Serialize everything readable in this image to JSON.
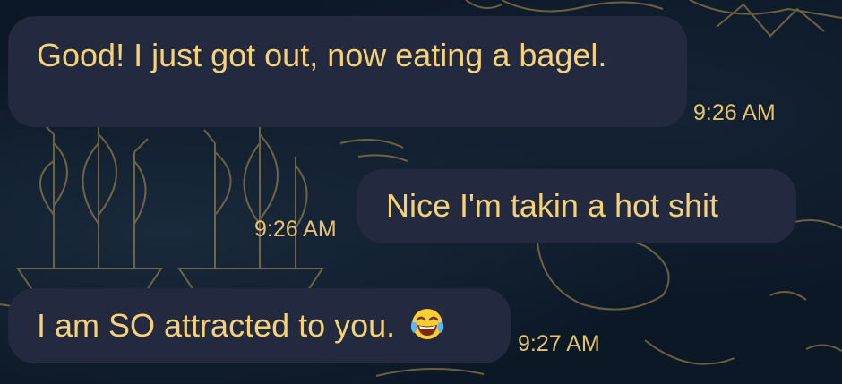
{
  "wallpaper": {
    "icon": "pirate-ships-map-pattern",
    "base_color": "#0c1826",
    "line_color": "#b89a52"
  },
  "messages": [
    {
      "direction": "incoming",
      "text": "Good! I just got out, now eating a bagel.",
      "time": "9:26 AM"
    },
    {
      "direction": "outgoing",
      "text": "Nice I'm takin a hot shit",
      "time": "9:26 AM"
    },
    {
      "direction": "incoming",
      "text": "I am SO attracted to you.",
      "emoji": "face-with-tears-of-joy-icon",
      "time": "9:27 AM"
    }
  ],
  "colors": {
    "bubble": "#232a40",
    "text": "#f5d27a",
    "time": "#e6c46e"
  }
}
